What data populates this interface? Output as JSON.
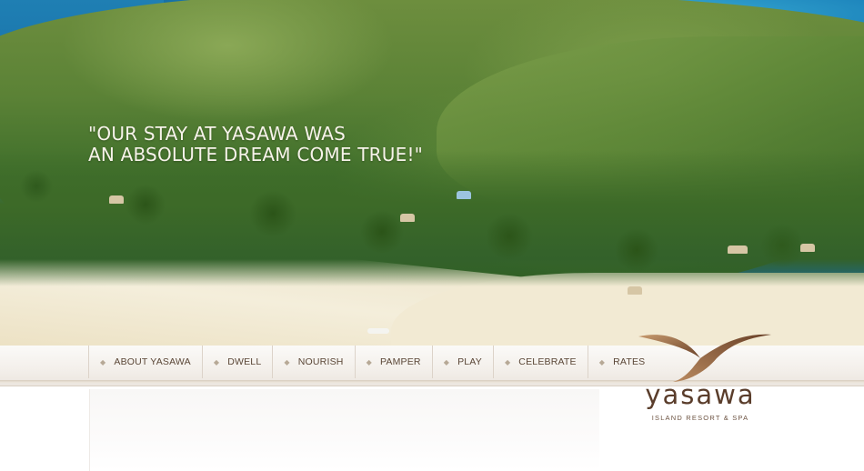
{
  "hero": {
    "quote_line1": "\"OUR STAY AT YASAWA WAS",
    "quote_line2": "AN ABSOLUTE DREAM COME TRUE!\""
  },
  "nav": {
    "items": [
      {
        "label": "ABOUT YASAWA"
      },
      {
        "label": "DWELL"
      },
      {
        "label": "NOURISH"
      },
      {
        "label": "PAMPER"
      },
      {
        "label": "PLAY"
      },
      {
        "label": "CELEBRATE"
      },
      {
        "label": "RATES"
      }
    ],
    "bullet_icon": "diamond-bullet-icon"
  },
  "logo": {
    "wordmark": "yasawa",
    "tagline": "ISLAND RESORT & SPA",
    "icon": "bird-wave-logo-icon"
  },
  "colors": {
    "nav_text": "#5a4636",
    "logo_brown": "#5a3d2b",
    "logo_gradient_light": "#c79a6e",
    "ocean": "#1a76ad",
    "foliage": "#5b8236",
    "sand": "#f4eedb"
  }
}
